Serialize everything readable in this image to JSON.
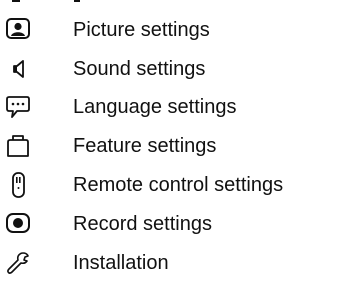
{
  "menu": {
    "items": [
      {
        "label": "Picture settings",
        "icon": "picture-icon"
      },
      {
        "label": "Sound settings",
        "icon": "speaker-icon"
      },
      {
        "label": "Language settings",
        "icon": "speech-bubble-icon"
      },
      {
        "label": "Feature settings",
        "icon": "feature-box-icon"
      },
      {
        "label": "Remote control settings",
        "icon": "remote-control-icon"
      },
      {
        "label": "Record settings",
        "icon": "record-icon"
      },
      {
        "label": "Installation",
        "icon": "wrench-icon"
      }
    ]
  },
  "colors": {
    "text": "#111111",
    "background": "#ffffff"
  }
}
